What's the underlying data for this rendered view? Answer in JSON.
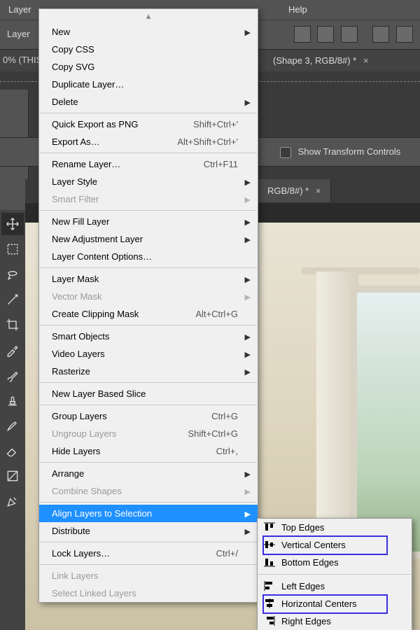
{
  "menubar": {
    "layer": "Layer",
    "help": "Help"
  },
  "row2": {
    "layer_label": "Layer"
  },
  "tab1": {
    "title": "(Shape 3, RGB/8#) *"
  },
  "zoom": {
    "label": "0% (THIS"
  },
  "optionsbar": {
    "show_transform": "Show Transform Controls"
  },
  "doc_tab": {
    "title": "RGB/8#) *"
  },
  "menu": {
    "new": "New",
    "copy_css": "Copy CSS",
    "copy_svg": "Copy SVG",
    "duplicate": "Duplicate Layer…",
    "delete": "Delete",
    "quick_export": "Quick Export as PNG",
    "quick_export_sc": "Shift+Ctrl+'",
    "export_as": "Export As…",
    "export_as_sc": "Alt+Shift+Ctrl+'",
    "rename": "Rename Layer…",
    "rename_sc": "Ctrl+F11",
    "layer_style": "Layer Style",
    "smart_filter": "Smart Filter",
    "new_fill": "New Fill Layer",
    "new_adj": "New Adjustment Layer",
    "layer_content": "Layer Content Options…",
    "layer_mask": "Layer Mask",
    "vector_mask": "Vector Mask",
    "clipping": "Create Clipping Mask",
    "clipping_sc": "Alt+Ctrl+G",
    "smart_objects": "Smart Objects",
    "video_layers": "Video Layers",
    "rasterize": "Rasterize",
    "slice": "New Layer Based Slice",
    "group": "Group Layers",
    "group_sc": "Ctrl+G",
    "ungroup": "Ungroup Layers",
    "ungroup_sc": "Shift+Ctrl+G",
    "hide": "Hide Layers",
    "hide_sc": "Ctrl+,",
    "arrange": "Arrange",
    "combine": "Combine Shapes",
    "align": "Align Layers to Selection",
    "distribute": "Distribute",
    "lock": "Lock Layers…",
    "lock_sc": "Ctrl+/",
    "link": "Link Layers",
    "select_linked": "Select Linked Layers"
  },
  "submenu": {
    "top": "Top Edges",
    "vcent": "Vertical Centers",
    "bottom": "Bottom Edges",
    "left": "Left Edges",
    "hcent": "Horizontal Centers",
    "right": "Right Edges"
  }
}
